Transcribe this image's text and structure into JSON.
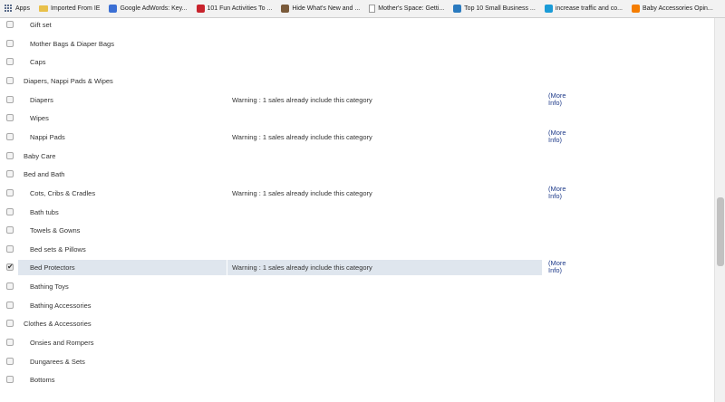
{
  "bookmarks": [
    {
      "label": "Apps",
      "icon": "apps-grid-icon"
    },
    {
      "label": "Imported From IE",
      "icon": "folder-icon"
    },
    {
      "label": "Google AdWords: Key...",
      "icon": "adwords-icon",
      "color": "#3b6fd4"
    },
    {
      "label": "101 Fun Activities To ...",
      "icon": "pinterest-icon",
      "color": "#c8232c"
    },
    {
      "label": "Hide What's New and ...",
      "icon": "photo-icon",
      "color": "#7a5a3a"
    },
    {
      "label": "Mother's Space: Getti...",
      "icon": "page-icon"
    },
    {
      "label": "Top 10 Small Business ...",
      "icon": "search-site-icon",
      "color": "#2a7abf"
    },
    {
      "label": "increase traffic and co...",
      "icon": "site-icon",
      "color": "#1a9bd7"
    },
    {
      "label": "Baby Accessories Opin...",
      "icon": "blogger-icon",
      "color": "#f57d00"
    }
  ],
  "rows": [
    {
      "label": "Gift set",
      "level": 2,
      "checked": false,
      "warning": "",
      "more": ""
    },
    {
      "label": "Mother Bags & Diaper Bags",
      "level": 2,
      "checked": false,
      "warning": "",
      "more": ""
    },
    {
      "label": "Caps",
      "level": 2,
      "checked": false,
      "warning": "",
      "more": ""
    },
    {
      "label": "Diapers, Nappi Pads & Wipes",
      "level": 1,
      "checked": false,
      "warning": "",
      "more": ""
    },
    {
      "label": "Diapers",
      "level": 2,
      "checked": false,
      "warning": "Warning : 1 sales already include this category",
      "more": "(More Info)"
    },
    {
      "label": "Wipes",
      "level": 2,
      "checked": false,
      "warning": "",
      "more": ""
    },
    {
      "label": "Nappi Pads",
      "level": 2,
      "checked": false,
      "warning": "Warning : 1 sales already include this category",
      "more": "(More Info)"
    },
    {
      "label": "Baby Care",
      "level": 1,
      "checked": false,
      "warning": "",
      "more": ""
    },
    {
      "label": "Bed and Bath",
      "level": 1,
      "checked": false,
      "warning": "",
      "more": ""
    },
    {
      "label": "Cots, Cribs & Cradles",
      "level": 2,
      "checked": false,
      "warning": "Warning : 1 sales already include this category",
      "more": "(More Info)"
    },
    {
      "label": "Bath tubs",
      "level": 2,
      "checked": false,
      "warning": "",
      "more": ""
    },
    {
      "label": "Towels & Gowns",
      "level": 2,
      "checked": false,
      "warning": "",
      "more": ""
    },
    {
      "label": "Bed sets & Pillows",
      "level": 2,
      "checked": false,
      "warning": "",
      "more": ""
    },
    {
      "label": "Bed Protectors",
      "level": 2,
      "checked": true,
      "warning": "Warning : 1 sales already include this category",
      "more": "(More Info)"
    },
    {
      "label": "Bathing Toys",
      "level": 2,
      "checked": false,
      "warning": "",
      "more": ""
    },
    {
      "label": "Bathing Accessories",
      "level": 2,
      "checked": false,
      "warning": "",
      "more": ""
    },
    {
      "label": "Clothes & Accessories",
      "level": 1,
      "checked": false,
      "warning": "",
      "more": ""
    },
    {
      "label": "Onsies and Rompers",
      "level": 2,
      "checked": false,
      "warning": "",
      "more": ""
    },
    {
      "label": "Dungarees & Sets",
      "level": 2,
      "checked": false,
      "warning": "",
      "more": ""
    },
    {
      "label": "Bottoms",
      "level": 2,
      "checked": false,
      "warning": "",
      "more": ""
    }
  ],
  "check_glyph": "✔"
}
